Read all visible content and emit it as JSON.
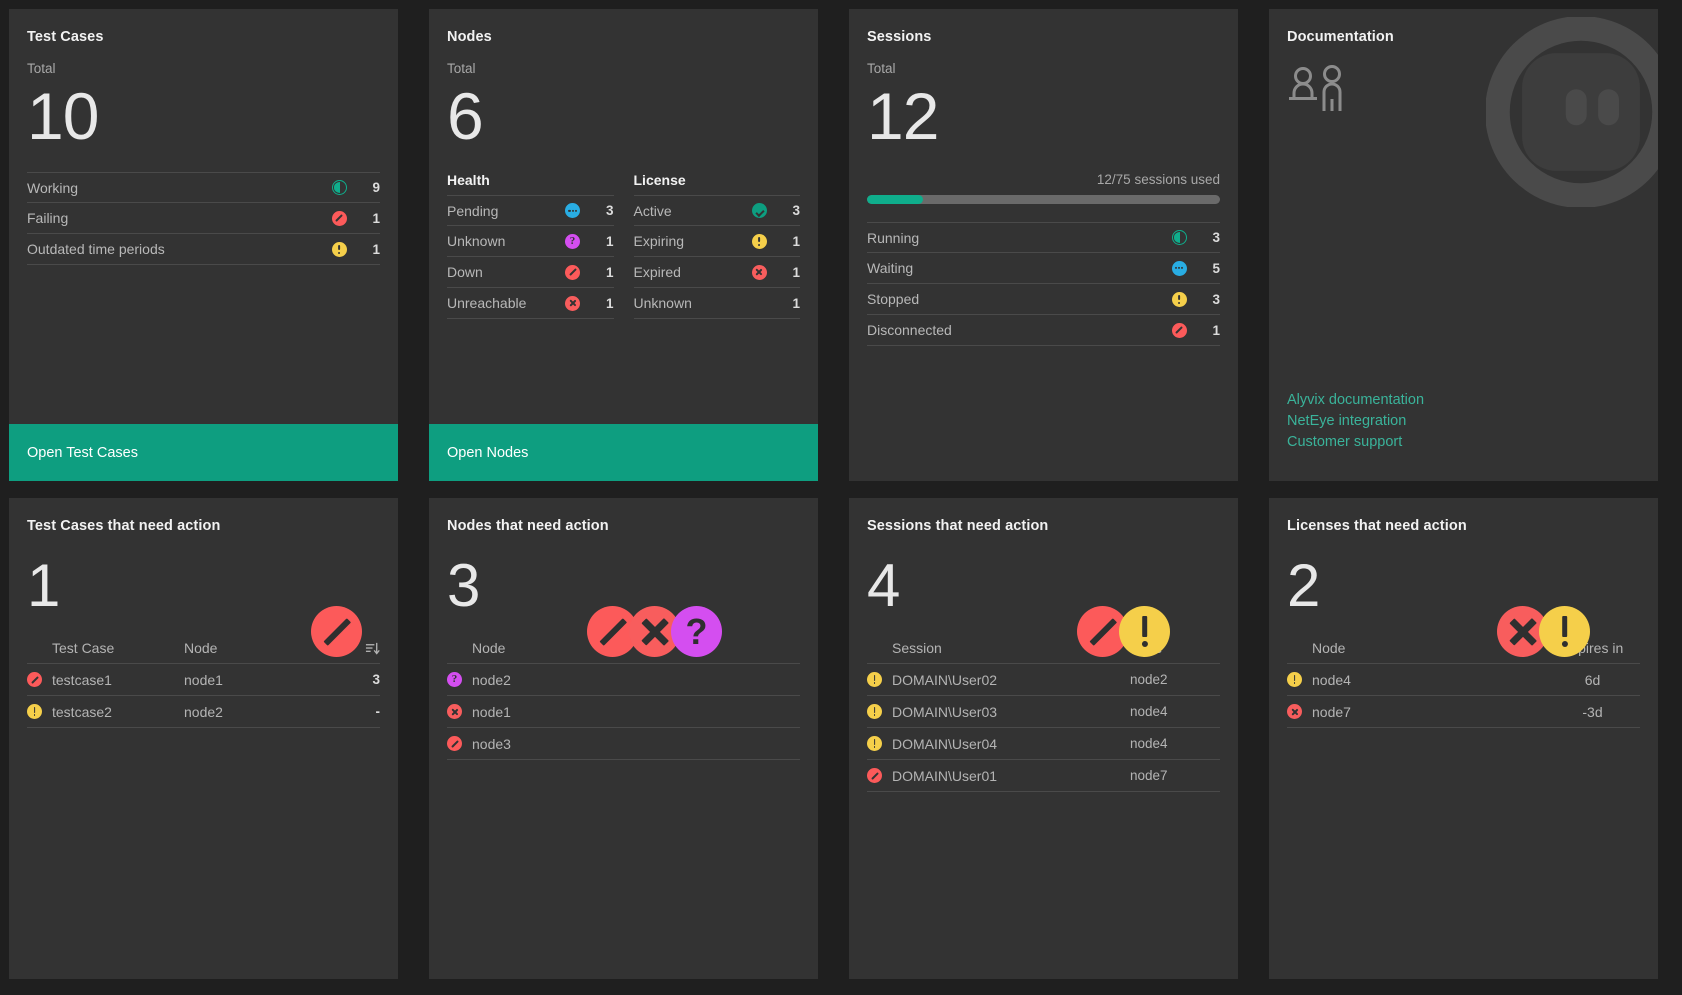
{
  "theme": {
    "accent": "#0e9e80",
    "card_bg": "#333333",
    "page_bg": "#1f1f1f",
    "link": "#3ab39a",
    "danger": "#fc5a5a",
    "warning": "#f5cf4a",
    "info": "#29ade3",
    "unknown": "#d44ef0",
    "ok": "#0d9e80"
  },
  "test_cases": {
    "title": "Test Cases",
    "total_label": "Total",
    "total": "10",
    "rows": [
      {
        "label": "Working",
        "icon": "pie-icon",
        "value": "9"
      },
      {
        "label": "Failing",
        "icon": "block-icon",
        "value": "1"
      },
      {
        "label": "Outdated time periods",
        "icon": "warning-icon",
        "value": "1"
      }
    ],
    "cta": "Open Test Cases"
  },
  "nodes": {
    "title": "Nodes",
    "total_label": "Total",
    "total": "6",
    "health_title": "Health",
    "health_rows": [
      {
        "label": "Pending",
        "icon": "waiting-icon",
        "value": "3"
      },
      {
        "label": "Unknown",
        "icon": "question-icon",
        "value": "1"
      },
      {
        "label": "Down",
        "icon": "block-icon",
        "value": "1"
      },
      {
        "label": "Unreachable",
        "icon": "x-icon",
        "value": "1"
      }
    ],
    "license_title": "License",
    "license_rows": [
      {
        "label": "Active",
        "icon": "check-icon",
        "value": "3"
      },
      {
        "label": "Expiring",
        "icon": "warning-icon",
        "value": "1"
      },
      {
        "label": "Expired",
        "icon": "x-icon",
        "value": "1"
      },
      {
        "label": "Unknown",
        "icon": "none",
        "value": "1"
      }
    ],
    "cta": "Open Nodes"
  },
  "sessions": {
    "title": "Sessions",
    "total_label": "Total",
    "total": "12",
    "usage_text": "12/75 sessions used",
    "usage_percent": 16,
    "rows": [
      {
        "label": "Running",
        "icon": "pie-icon",
        "value": "3"
      },
      {
        "label": "Waiting",
        "icon": "waiting-icon",
        "value": "5"
      },
      {
        "label": "Stopped",
        "icon": "warning-icon",
        "value": "3"
      },
      {
        "label": "Disconnected",
        "icon": "block-icon",
        "value": "1"
      }
    ]
  },
  "documentation": {
    "title": "Documentation",
    "links": [
      "Alyvix documentation",
      "NetEye integration",
      "Customer support"
    ]
  },
  "test_cases_action": {
    "title": "Test Cases that need action",
    "count": "1",
    "badges": [
      "block-icon"
    ],
    "columns": {
      "main": "Test Case",
      "second": "Node",
      "sort": "sort-icon"
    },
    "rows": [
      {
        "icon": "block-icon",
        "name": "testcase1",
        "node": "node1",
        "value": "3"
      },
      {
        "icon": "warning-icon",
        "name": "testcase2",
        "node": "node2",
        "value": "-"
      }
    ]
  },
  "nodes_action": {
    "title": "Nodes that need action",
    "count": "3",
    "badges": [
      "block-icon",
      "x-icon",
      "question-icon"
    ],
    "columns": {
      "main": "Node"
    },
    "rows": [
      {
        "icon": "question-icon",
        "name": "node2"
      },
      {
        "icon": "x-icon",
        "name": "node1"
      },
      {
        "icon": "block-icon",
        "name": "node3"
      }
    ]
  },
  "sessions_action": {
    "title": "Sessions that need action",
    "count": "4",
    "badges": [
      "block-icon",
      "warning-icon"
    ],
    "columns": {
      "main": "Session",
      "second": "Node"
    },
    "rows": [
      {
        "icon": "warning-icon",
        "name": "DOMAIN\\User02",
        "node": "node2"
      },
      {
        "icon": "warning-icon",
        "name": "DOMAIN\\User03",
        "node": "node4"
      },
      {
        "icon": "warning-icon",
        "name": "DOMAIN\\User04",
        "node": "node4"
      },
      {
        "icon": "block-icon",
        "name": "DOMAIN\\User01",
        "node": "node7"
      }
    ]
  },
  "licenses_action": {
    "title": "Licenses that need action",
    "count": "2",
    "badges": [
      "x-icon",
      "warning-icon"
    ],
    "columns": {
      "main": "Node",
      "second": "Expires in"
    },
    "rows": [
      {
        "icon": "warning-icon",
        "name": "node4",
        "expires": "6d"
      },
      {
        "icon": "x-icon",
        "name": "node7",
        "expires": "-3d"
      }
    ]
  }
}
